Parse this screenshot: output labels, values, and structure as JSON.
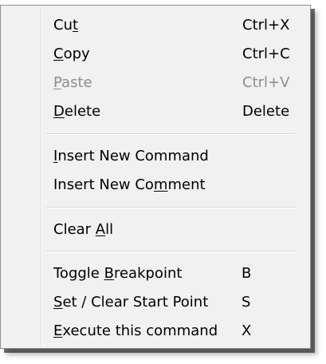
{
  "menu": {
    "items": [
      {
        "before": "Cu",
        "mnemonic": "t",
        "after": "",
        "shortcut": "Ctrl+X",
        "enabled": true
      },
      {
        "before": "",
        "mnemonic": "C",
        "after": "opy",
        "shortcut": "Ctrl+C",
        "enabled": true
      },
      {
        "before": "",
        "mnemonic": "P",
        "after": "aste",
        "shortcut": "Ctrl+V",
        "enabled": false
      },
      {
        "before": "",
        "mnemonic": "D",
        "after": "elete",
        "shortcut": "Delete",
        "enabled": true
      },
      {
        "before": "",
        "mnemonic": "I",
        "after": "nsert New Command",
        "shortcut": "",
        "enabled": true
      },
      {
        "before": "Insert New Co",
        "mnemonic": "m",
        "after": "ment",
        "shortcut": "",
        "enabled": true
      },
      {
        "before": "Clear ",
        "mnemonic": "A",
        "after": "ll",
        "shortcut": "",
        "enabled": true
      },
      {
        "before": "Toggle ",
        "mnemonic": "B",
        "after": "reakpoint",
        "shortcut": "B",
        "enabled": true
      },
      {
        "before": "",
        "mnemonic": "S",
        "after": "et / Clear Start Point",
        "shortcut": "S",
        "enabled": true
      },
      {
        "before": "",
        "mnemonic": "E",
        "after": "xecute this command",
        "shortcut": "X",
        "enabled": true
      }
    ]
  }
}
